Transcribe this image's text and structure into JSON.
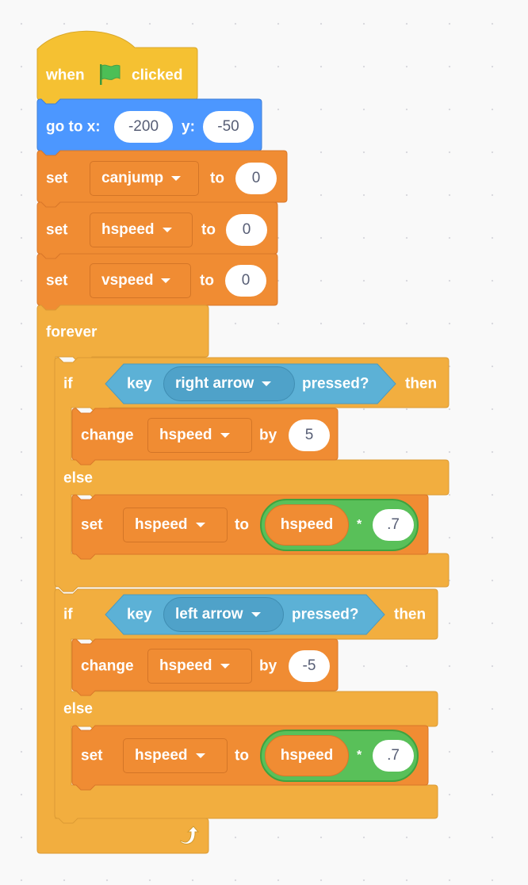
{
  "script": {
    "hat": {
      "when": "when",
      "flag_icon": "green-flag",
      "clicked": "clicked"
    },
    "goto": {
      "label": "go to x:",
      "x": "-200",
      "y_label": "y:",
      "y": "-50"
    },
    "sets": [
      {
        "label": "set",
        "variable": "canjump",
        "to": "to",
        "value": "0"
      },
      {
        "label": "set",
        "variable": "hspeed",
        "to": "to",
        "value": "0"
      },
      {
        "label": "set",
        "variable": "vspeed",
        "to": "to",
        "value": "0"
      }
    ],
    "forever": {
      "label": "forever",
      "loop_icon": "loop-arrow"
    },
    "ifs": [
      {
        "if": "if",
        "key": "key",
        "key_option": "right arrow",
        "pressed": "pressed?",
        "then": "then",
        "change": {
          "label": "change",
          "variable": "hspeed",
          "by": "by",
          "value": "5"
        },
        "else": "else",
        "set": {
          "label": "set",
          "variable": "hspeed",
          "to": "to",
          "reporter": "hspeed",
          "op": "*",
          "value": ".7"
        }
      },
      {
        "if": "if",
        "key": "key",
        "key_option": "left arrow",
        "pressed": "pressed?",
        "then": "then",
        "change": {
          "label": "change",
          "variable": "hspeed",
          "by": "by",
          "value": "-5"
        },
        "else": "else",
        "set": {
          "label": "set",
          "variable": "hspeed",
          "to": "to",
          "reporter": "hspeed",
          "op": "*",
          "value": ".7"
        }
      }
    ]
  },
  "colors": {
    "events": "#f5c132",
    "motion": "#4c97ff",
    "variables": "#f08c33",
    "control": "#f2ae3f",
    "sensing": "#5cb1d6",
    "operators": "#59c059"
  }
}
